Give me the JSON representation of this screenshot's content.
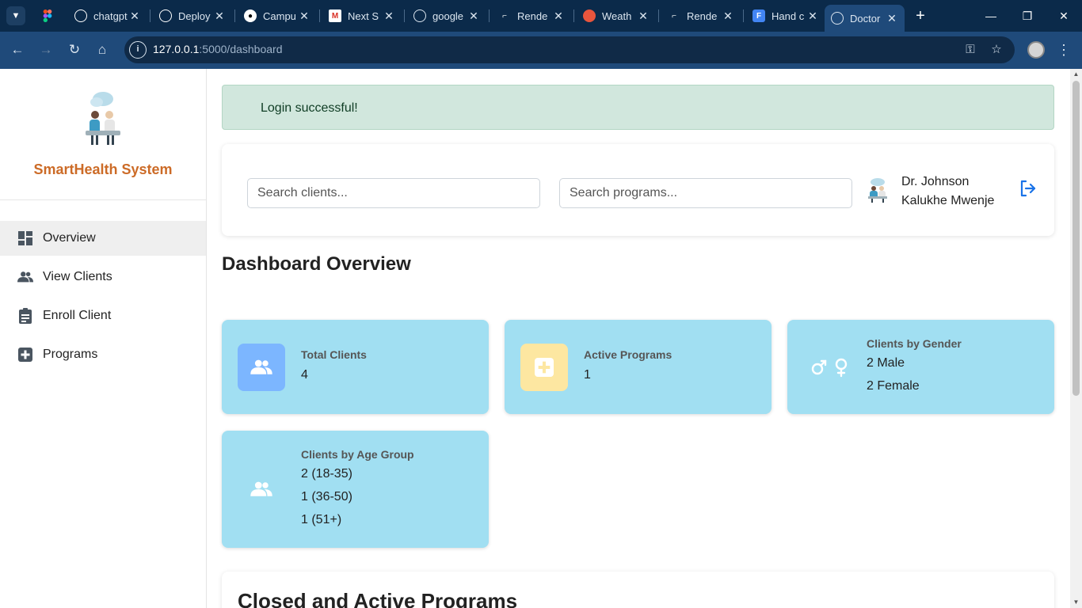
{
  "browser": {
    "tabs": [
      {
        "label": "",
        "icon": "figma-icon"
      },
      {
        "label": "chatgpt",
        "icon": "openai-icon"
      },
      {
        "label": "Deploy",
        "icon": "openai-icon"
      },
      {
        "label": "Campu",
        "icon": "github-icon"
      },
      {
        "label": "Next S",
        "icon": "gmail-icon"
      },
      {
        "label": "google",
        "icon": "globe-icon"
      },
      {
        "label": "Rende",
        "icon": "render-icon"
      },
      {
        "label": "Weath",
        "icon": "weather-icon"
      },
      {
        "label": "Rende",
        "icon": "render-icon"
      },
      {
        "label": "Hand c",
        "icon": "forms-icon"
      },
      {
        "label": "Doctor",
        "icon": "globe-icon"
      }
    ],
    "url_host": "127.0.0.1",
    "url_path": ":5000/dashboard"
  },
  "sidebar": {
    "brand": "SmartHealth System",
    "items": [
      {
        "label": "Overview",
        "icon": "dashboard-icon"
      },
      {
        "label": "View Clients",
        "icon": "users-icon"
      },
      {
        "label": "Enroll Client",
        "icon": "clipboard-icon"
      },
      {
        "label": "Programs",
        "icon": "plus-square-icon"
      }
    ]
  },
  "alert": {
    "message": "Login successful!"
  },
  "search": {
    "clients_placeholder": "Search clients...",
    "programs_placeholder": "Search programs..."
  },
  "user": {
    "name": "Dr. Johnson Kalukhe Mwenje"
  },
  "main": {
    "title": "Dashboard Overview",
    "stats": {
      "total_clients": {
        "label": "Total Clients",
        "value": "4"
      },
      "active_programs": {
        "label": "Active Programs",
        "value": "1"
      },
      "gender": {
        "label": "Clients by Gender",
        "male": "2 Male",
        "female": "2 Female"
      },
      "age": {
        "label": "Clients by Age Group",
        "g1": "2 (18-35)",
        "g2": "1 (36-50)",
        "g3": "1 (51+)"
      }
    },
    "programs_section_title": "Closed and Active Programs"
  },
  "colors": {
    "tabbar": "#0b2a4a",
    "addressbar": "#1f4a7a",
    "brand": "#cc6b27",
    "card": "#a1dff2",
    "alert_bg": "#d1e7dd",
    "icon_blue": "#7cb6ff",
    "icon_yellow": "#fde7a1",
    "logout_blue": "#1a73e8"
  }
}
